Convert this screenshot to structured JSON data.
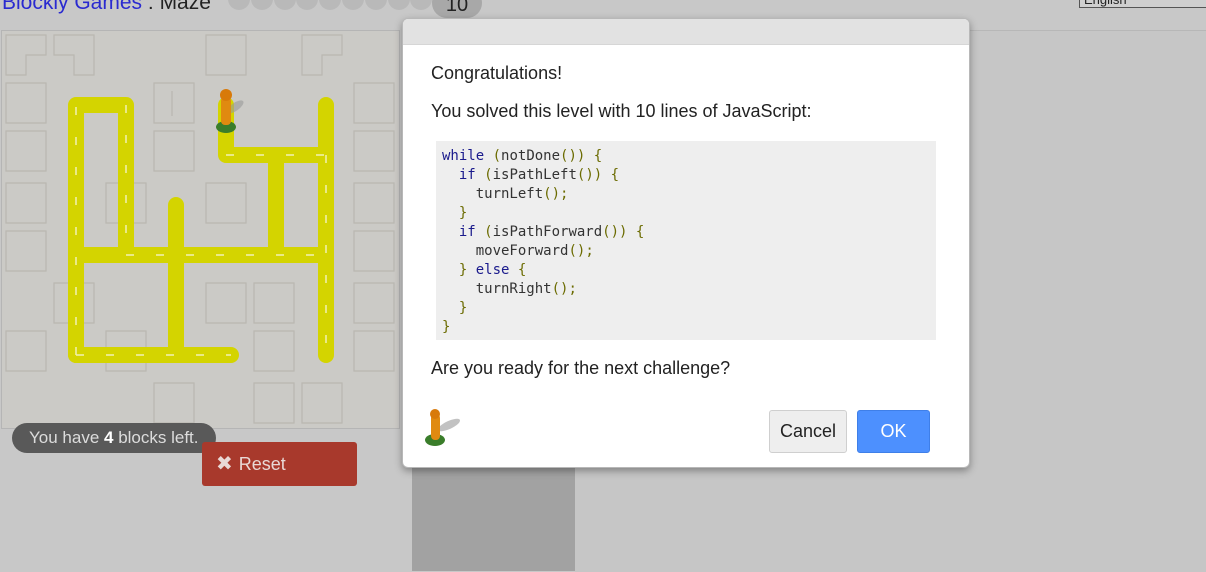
{
  "header": {
    "app_link": "Blockly Games",
    "separator": " : ",
    "game_name": "Maze",
    "level_count": 10,
    "current_level": "10",
    "language": "English"
  },
  "game": {
    "blocks_left_prefix": "You have ",
    "blocks_left_count": "4",
    "blocks_left_suffix": " blocks left.",
    "reset_label": "Reset",
    "reset_icon": "close-x-icon"
  },
  "dialog": {
    "congrats": "Congratulations!",
    "solved_text": "You solved this level with 10 lines of JavaScript:",
    "code_lines": [
      "while (notDone()) {",
      "  if (isPathLeft()) {",
      "    turnLeft();",
      "  }",
      "  if (isPathForward()) {",
      "    moveForward();",
      "  } else {",
      "    turnRight();",
      "  }",
      "}"
    ],
    "next_prompt": "Are you ready for the next challenge?",
    "cancel_label": "Cancel",
    "ok_label": "OK"
  },
  "colors": {
    "ok_button": "#4d90fe",
    "reset_button": "#a8392c",
    "path": "#d4d400",
    "overlay_bg": "#c8c8c8"
  }
}
